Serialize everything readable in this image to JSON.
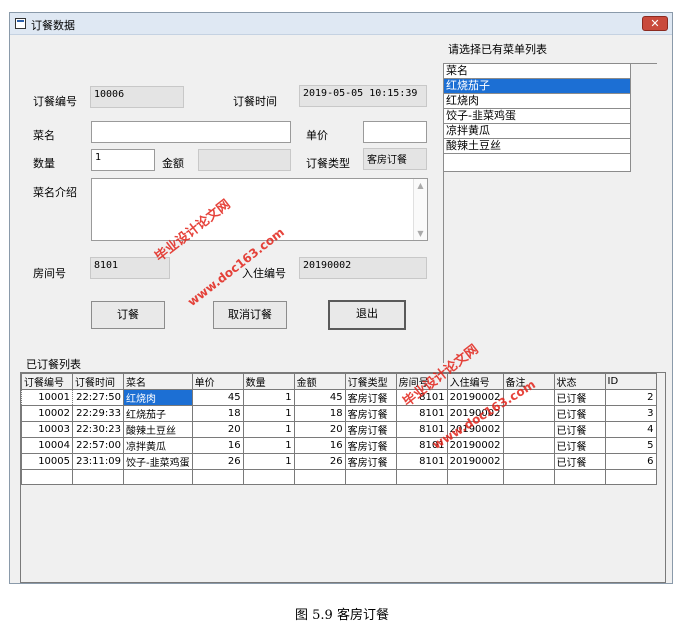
{
  "window": {
    "title": "订餐数据",
    "close_glyph": "✕"
  },
  "form": {
    "order_no_label": "订餐编号",
    "order_no_value": "10006",
    "order_time_label": "订餐时间",
    "order_time_value": "2019-05-05 10:15:39",
    "dish_name_label": "菜名",
    "dish_name_value": "",
    "unit_price_label": "单价",
    "unit_price_value": "",
    "quantity_label": "数量",
    "quantity_value": "1",
    "amount_label": "金额",
    "amount_value": "",
    "order_type_label": "订餐类型",
    "order_type_value": "客房订餐",
    "dish_desc_label": "菜名介绍",
    "dish_desc_value": "",
    "room_no_label": "房间号",
    "room_no_value": "8101",
    "checkin_no_label": "入住编号",
    "checkin_no_value": "20190002"
  },
  "buttons": {
    "order": "订餐",
    "cancel": "取消订餐",
    "exit": "退出"
  },
  "menu_list": {
    "title": "请选择已有菜单列表",
    "header": "菜名",
    "items": [
      "红烧茄子",
      "红烧肉",
      "饺子-韭菜鸡蛋",
      "凉拌黄瓜",
      "酸辣土豆丝"
    ],
    "selected_index": 0
  },
  "orders": {
    "title": "已订餐列表",
    "columns": [
      "订餐编号",
      "订餐时间",
      "菜名",
      "单价",
      "数量",
      "金额",
      "订餐类型",
      "房间号",
      "入住编号",
      "备注",
      "状态",
      "ID"
    ],
    "rows": [
      [
        "10001",
        "22:27:50",
        "红烧肉",
        "45",
        "1",
        "45",
        "客房订餐",
        "8101",
        "20190002",
        "",
        "已订餐",
        "2"
      ],
      [
        "10002",
        "22:29:33",
        "红烧茄子",
        "18",
        "1",
        "18",
        "客房订餐",
        "8101",
        "20190002",
        "",
        "已订餐",
        "3"
      ],
      [
        "10003",
        "22:30:23",
        "酸辣土豆丝",
        "20",
        "1",
        "20",
        "客房订餐",
        "8101",
        "20190002",
        "",
        "已订餐",
        "4"
      ],
      [
        "10004",
        "22:57:00",
        "凉拌黄瓜",
        "16",
        "1",
        "16",
        "客房订餐",
        "8101",
        "20190002",
        "",
        "已订餐",
        "5"
      ],
      [
        "10005",
        "23:11:09",
        "饺子-韭菜鸡蛋",
        "26",
        "1",
        "26",
        "客房订餐",
        "8101",
        "20190002",
        "",
        "已订餐",
        "6"
      ]
    ],
    "selected_cell": [
      0,
      2
    ]
  },
  "watermarks": [
    "毕业设计论文网",
    "www.doc163.com"
  ],
  "caption": "图 5.9 客房订餐",
  "colors": {
    "selection": "#1c6fd4",
    "watermark": "#e2231a",
    "close": "#c94a3c"
  }
}
